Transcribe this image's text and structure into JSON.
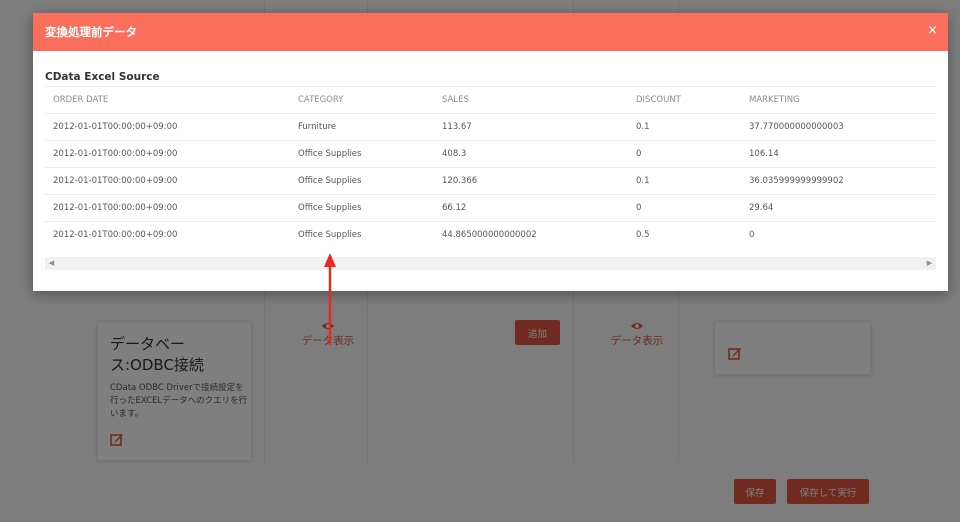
{
  "modal": {
    "title": "変換処理前データ",
    "close_glyph": "×",
    "source_title": "CData Excel Source",
    "columns": [
      "ORDER DATE",
      "CATEGORY",
      "SALES",
      "DISCOUNT",
      "MARKETING"
    ],
    "rows": [
      [
        "2012-01-01T00:00:00+09:00",
        "Furniture",
        "113.67",
        "0.1",
        "37.770000000000003"
      ],
      [
        "2012-01-01T00:00:00+09:00",
        "Office Supplies",
        "408.3",
        "0",
        "106.14"
      ],
      [
        "2012-01-01T00:00:00+09:00",
        "Office Supplies",
        "120.366",
        "0.1",
        "36.035999999999902"
      ],
      [
        "2012-01-01T00:00:00+09:00",
        "Office Supplies",
        "66.12",
        "0",
        "29.64"
      ],
      [
        "2012-01-01T00:00:00+09:00",
        "Office Supplies",
        "44.865000000000002",
        "0.5",
        "0"
      ]
    ],
    "scroll_left_glyph": "◀",
    "scroll_right_glyph": "▶"
  },
  "background": {
    "card_odbc_title": "データベース:ODBC接続",
    "card_odbc_desc": "CData ODBC Driverで接続設定を行ったEXCELデータへのクエリを行います。",
    "view_data_label_1": "データ表示",
    "view_data_label_2": "データ表示",
    "add_label": "追加",
    "save_label": "保存",
    "save_run_label": "保存して実行"
  },
  "colors": {
    "accent": "#fa6f5c",
    "accent_dark": "#e05541",
    "overlay": "rgba(0,0,0,0.5)"
  },
  "icons": [
    "close-icon",
    "edit-icon",
    "eye-icon",
    "chevron-left-icon",
    "chevron-right-icon"
  ]
}
